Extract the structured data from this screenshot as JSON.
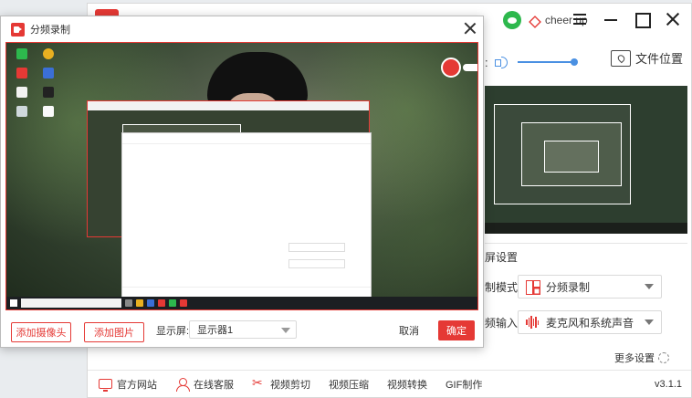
{
  "main_window": {
    "user": {
      "name": "cheer up"
    },
    "volume": {
      "colon": ":",
      "level": 1.0
    },
    "folder_button": "文件位置",
    "settings_header": "屏设置",
    "settings": [
      {
        "label": "制模式",
        "value": "分频录制",
        "icon": "grid-icon"
      },
      {
        "label": "频输入",
        "value": "麦克风和系统声音",
        "icon": "wave-icon"
      }
    ],
    "more_settings": "更多设置",
    "footer": {
      "items": [
        {
          "label": "官方网站",
          "icon": "monitor-icon"
        },
        {
          "label": "在线客服",
          "icon": "person-icon"
        },
        {
          "label": "视频剪切",
          "icon": "scissors-icon"
        },
        {
          "label": "视频压缩",
          "icon": ""
        },
        {
          "label": "视频转换",
          "icon": ""
        },
        {
          "label": "GIF制作",
          "icon": ""
        }
      ],
      "version": "v3.1.1"
    },
    "accent": "#e53935"
  },
  "dialog": {
    "title": "分频录制",
    "add_camera": "添加摄像头",
    "add_image": "添加图片",
    "screen_label": "显示屏:",
    "screen_value": "显示器1",
    "cancel": "取消",
    "confirm": "确定"
  }
}
